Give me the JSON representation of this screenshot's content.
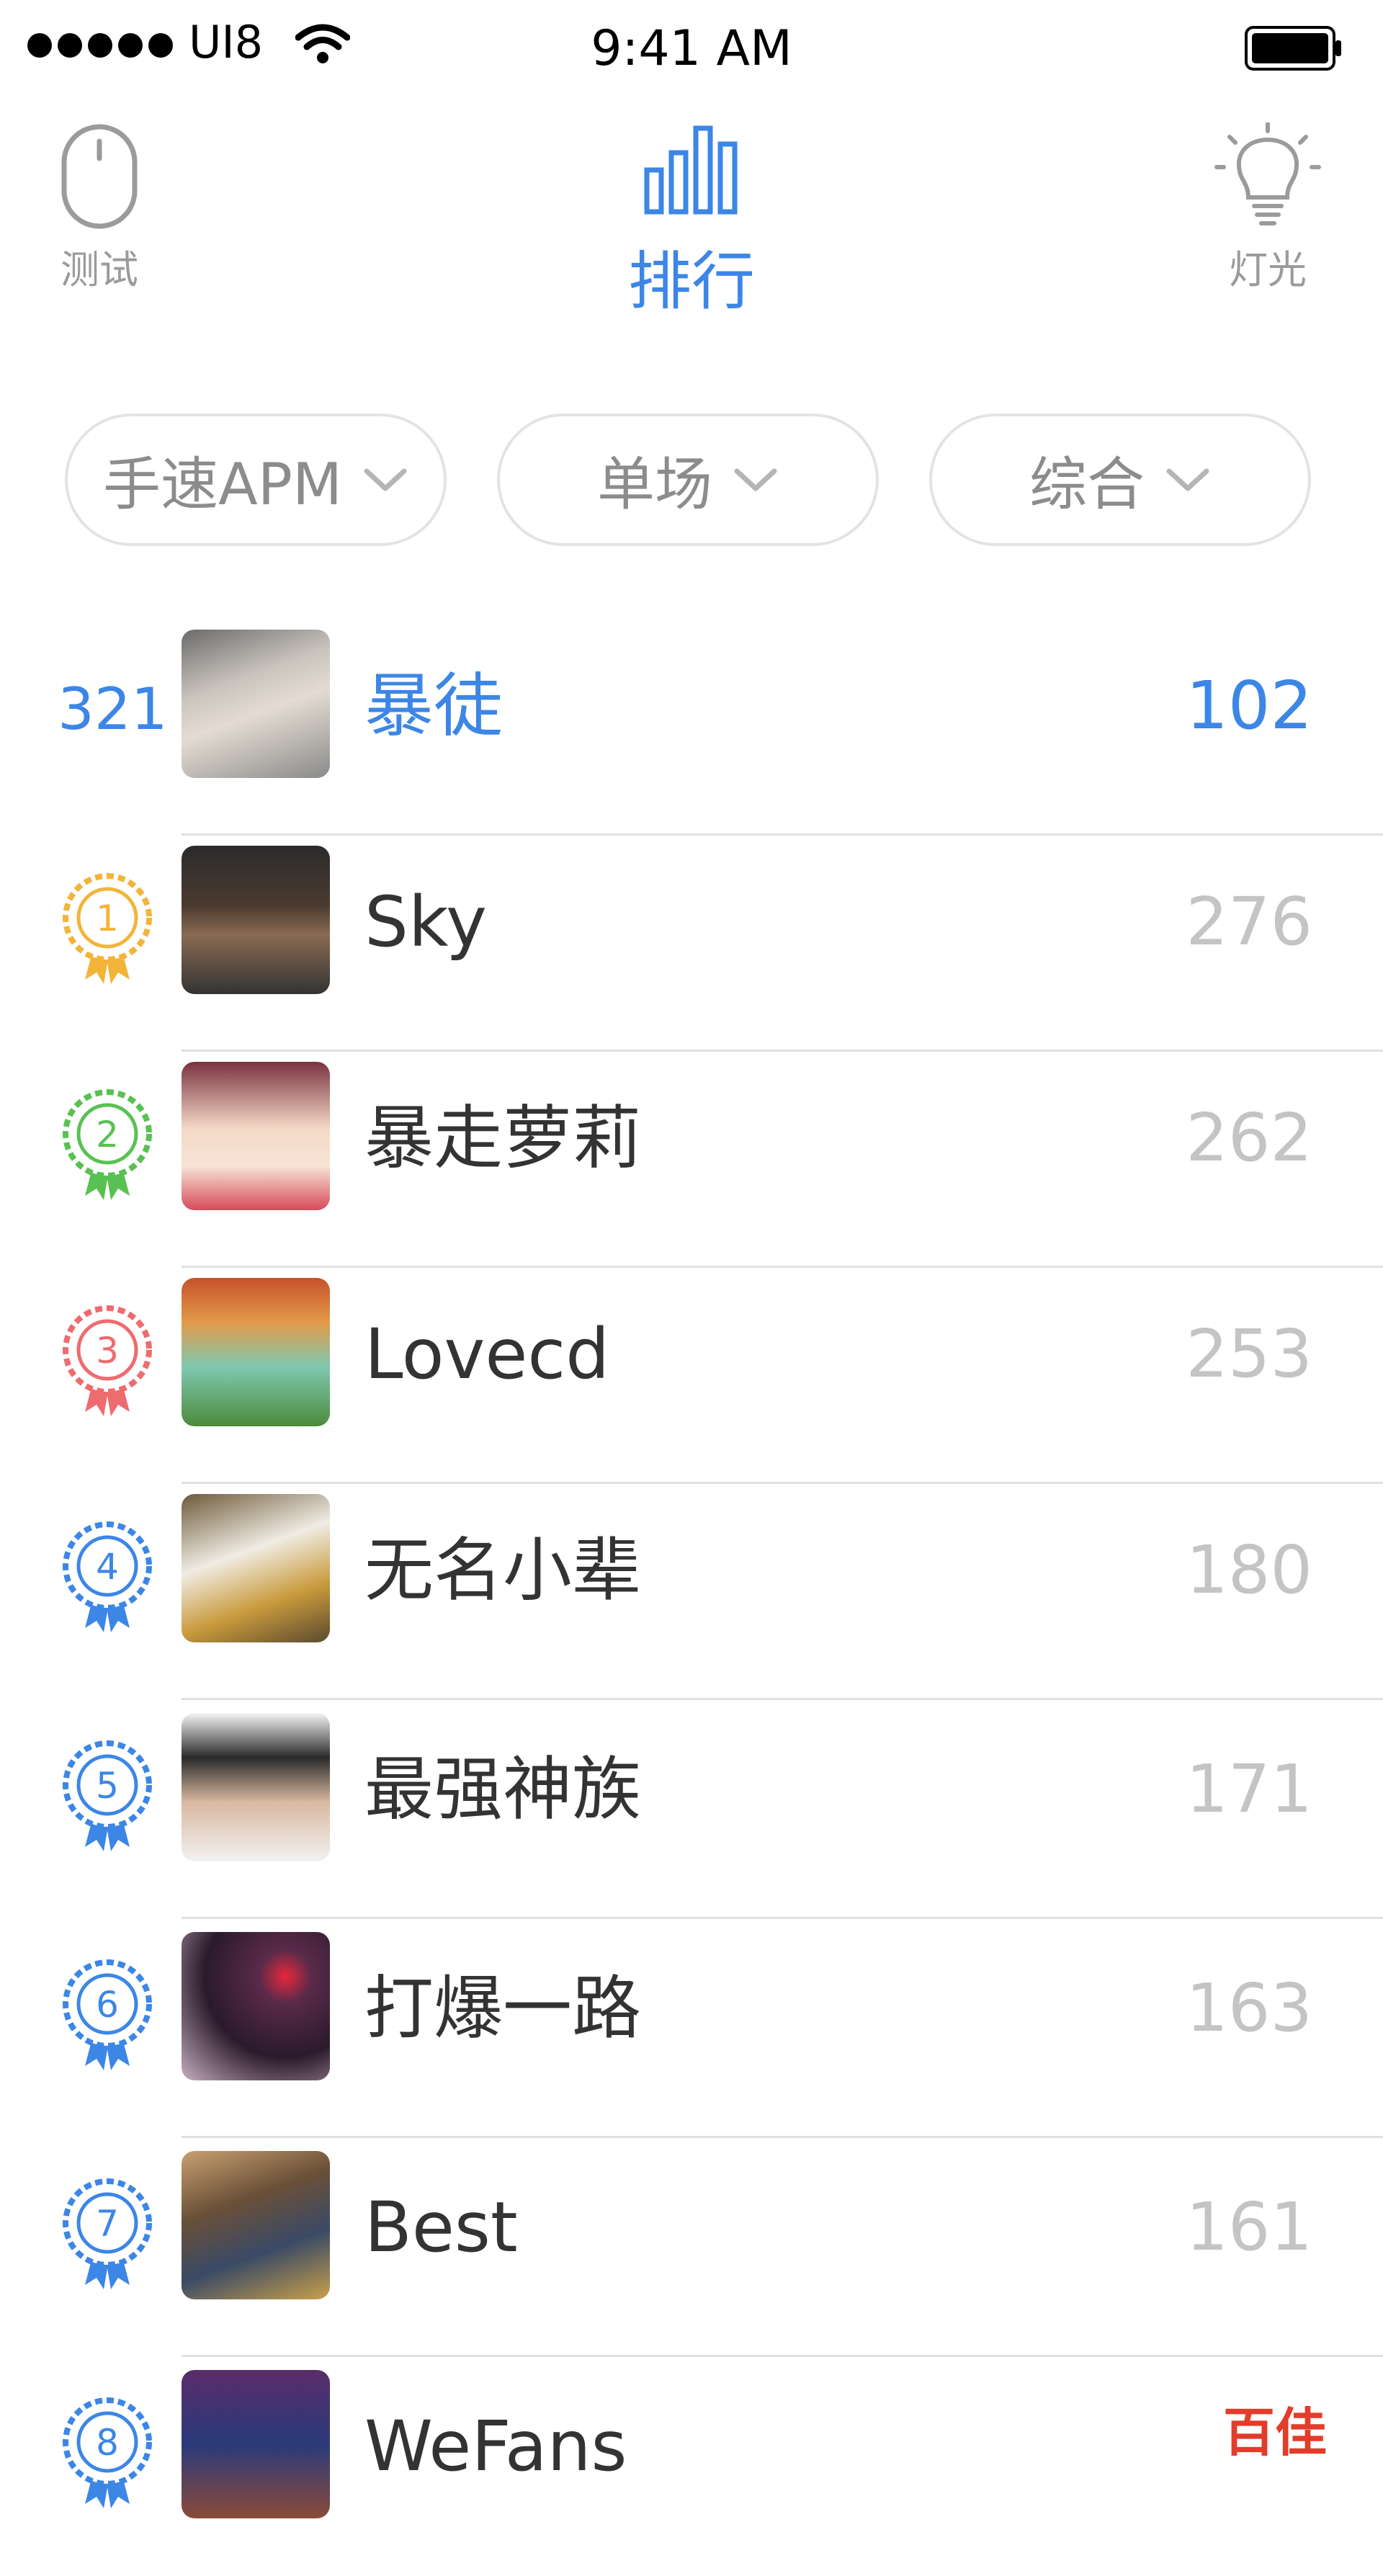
{
  "status_bar": {
    "carrier": "UI8",
    "time": "9:41 AM"
  },
  "tabs": [
    {
      "label": "测试",
      "icon": "mouse-icon"
    },
    {
      "label": "排行",
      "icon": "bar-chart-icon"
    },
    {
      "label": "灯光",
      "icon": "lightbulb-icon"
    }
  ],
  "filters": [
    {
      "label": "手速APM"
    },
    {
      "label": "单场"
    },
    {
      "label": "综合"
    }
  ],
  "self_row": {
    "rank": "321",
    "name": "暴徒",
    "score": "102"
  },
  "rows": [
    {
      "rank": "1",
      "name": "Sky",
      "score": "276",
      "medal_color": "#f3b43a"
    },
    {
      "rank": "2",
      "name": "暴走萝莉",
      "score": "262",
      "medal_color": "#59c152"
    },
    {
      "rank": "3",
      "name": "Lovecd",
      "score": "253",
      "medal_color": "#ee6b6e"
    },
    {
      "rank": "4",
      "name": "无名小辈",
      "score": "180",
      "medal_color": "#3c86e6"
    },
    {
      "rank": "5",
      "name": "最强神族",
      "score": "171",
      "medal_color": "#3c86e6"
    },
    {
      "rank": "6",
      "name": "打爆一路",
      "score": "163",
      "medal_color": "#3c86e6"
    },
    {
      "rank": "7",
      "name": "Best",
      "score": "161",
      "medal_color": "#3c86e6"
    },
    {
      "rank": "8",
      "name": "WeFans",
      "score": "",
      "medal_color": "#3c86e6"
    }
  ],
  "watermark": "百佳",
  "colors": {
    "accent": "#3c86e6",
    "muted": "#9b9b9b",
    "score": "#c4c4c4"
  }
}
